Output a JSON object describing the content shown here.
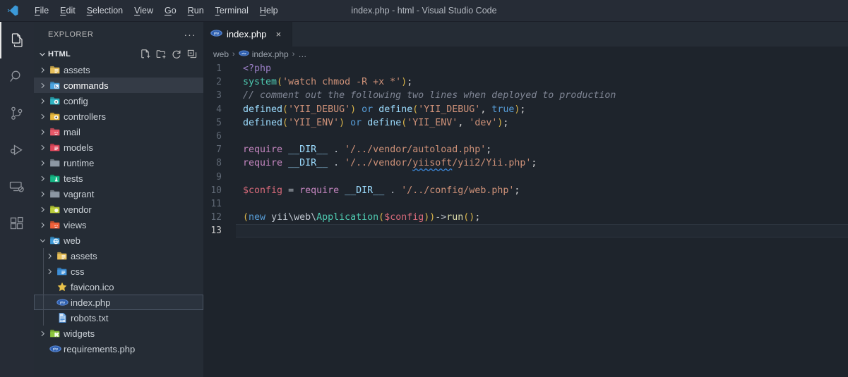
{
  "window": {
    "title": "index.php - html - Visual Studio Code",
    "logo_icon": "vscode-logo-icon"
  },
  "menubar": {
    "items": [
      {
        "label": "File",
        "mnemonic": "F"
      },
      {
        "label": "Edit",
        "mnemonic": "E"
      },
      {
        "label": "Selection",
        "mnemonic": "S"
      },
      {
        "label": "View",
        "mnemonic": "V"
      },
      {
        "label": "Go",
        "mnemonic": "G"
      },
      {
        "label": "Run",
        "mnemonic": "R"
      },
      {
        "label": "Terminal",
        "mnemonic": "T"
      },
      {
        "label": "Help",
        "mnemonic": "H"
      }
    ]
  },
  "activitybar": {
    "items": [
      {
        "name": "explorer",
        "icon": "files-icon",
        "active": true
      },
      {
        "name": "search",
        "icon": "search-icon",
        "active": false
      },
      {
        "name": "source-control",
        "icon": "source-control-icon",
        "active": false
      },
      {
        "name": "run-and-debug",
        "icon": "run-debug-icon",
        "active": false
      },
      {
        "name": "remote-explorer",
        "icon": "remote-explorer-icon",
        "active": false
      },
      {
        "name": "extensions",
        "icon": "extensions-icon",
        "active": false
      }
    ]
  },
  "sidebar": {
    "title": "EXPLORER",
    "more_actions_label": "···",
    "section": {
      "name": "HTML",
      "expanded": true,
      "actions": [
        {
          "name": "new-file",
          "icon": "new-file-icon"
        },
        {
          "name": "new-folder",
          "icon": "new-folder-icon"
        },
        {
          "name": "refresh-explorer",
          "icon": "refresh-icon"
        },
        {
          "name": "collapse-folders",
          "icon": "collapse-all-icon"
        }
      ]
    },
    "tree": [
      {
        "label": "assets",
        "kind": "folder",
        "icon": "folder-assets-icon",
        "color": "#e8c05a",
        "depth": 1,
        "expanded": false,
        "state": "normal"
      },
      {
        "label": "commands",
        "kind": "folder",
        "icon": "folder-commands-icon",
        "color": "#4aa3e0",
        "depth": 1,
        "expanded": false,
        "state": "focused"
      },
      {
        "label": "config",
        "kind": "folder",
        "icon": "folder-config-icon",
        "color": "#2fb6c4",
        "depth": 1,
        "expanded": false,
        "state": "normal"
      },
      {
        "label": "controllers",
        "kind": "folder",
        "icon": "folder-controllers-icon",
        "color": "#e8b93e",
        "depth": 1,
        "expanded": false,
        "state": "normal"
      },
      {
        "label": "mail",
        "kind": "folder",
        "icon": "folder-mail-icon",
        "color": "#e8596a",
        "depth": 1,
        "expanded": false,
        "state": "normal"
      },
      {
        "label": "models",
        "kind": "folder",
        "icon": "folder-models-icon",
        "color": "#e0485c",
        "depth": 1,
        "expanded": false,
        "state": "normal"
      },
      {
        "label": "runtime",
        "kind": "folder",
        "icon": "folder-icon",
        "color": "#8c97a3",
        "depth": 1,
        "expanded": false,
        "state": "normal"
      },
      {
        "label": "tests",
        "kind": "folder",
        "icon": "folder-tests-icon",
        "color": "#16b886",
        "depth": 1,
        "expanded": false,
        "state": "normal"
      },
      {
        "label": "vagrant",
        "kind": "folder",
        "icon": "folder-icon",
        "color": "#8c97a3",
        "depth": 1,
        "expanded": false,
        "state": "normal"
      },
      {
        "label": "vendor",
        "kind": "folder",
        "icon": "folder-vendor-icon",
        "color": "#bccf3b",
        "depth": 1,
        "expanded": false,
        "state": "normal"
      },
      {
        "label": "views",
        "kind": "folder",
        "icon": "folder-views-icon",
        "color": "#f0603a",
        "depth": 1,
        "expanded": false,
        "state": "normal"
      },
      {
        "label": "web",
        "kind": "folder",
        "icon": "folder-web-icon",
        "color": "#3e9ad8",
        "depth": 1,
        "expanded": true,
        "state": "normal"
      },
      {
        "label": "assets",
        "kind": "folder",
        "icon": "folder-assets-icon",
        "color": "#e8c05a",
        "depth": 2,
        "expanded": false,
        "state": "normal"
      },
      {
        "label": "css",
        "kind": "folder",
        "icon": "folder-css-icon",
        "color": "#3d8fd8",
        "depth": 2,
        "expanded": false,
        "state": "normal"
      },
      {
        "label": "favicon.ico",
        "kind": "file",
        "icon": "star-icon",
        "color": "#e8c14a",
        "depth": 2,
        "expanded": false,
        "state": "normal"
      },
      {
        "label": "index.php",
        "kind": "file",
        "icon": "php-icon",
        "color": "#4a76c4",
        "depth": 2,
        "expanded": false,
        "state": "selected"
      },
      {
        "label": "robots.txt",
        "kind": "file",
        "icon": "text-file-icon",
        "color": "#4a8fd8",
        "depth": 2,
        "expanded": false,
        "state": "normal"
      },
      {
        "label": "widgets",
        "kind": "folder",
        "icon": "folder-widgets-icon",
        "color": "#8cc63f",
        "depth": 1,
        "expanded": false,
        "state": "normal"
      },
      {
        "label": "requirements.php",
        "kind": "file",
        "icon": "php-icon",
        "color": "#4a76c4",
        "depth": 1,
        "expanded": false,
        "state": "normal"
      }
    ]
  },
  "editor": {
    "tabs": [
      {
        "label": "index.php",
        "icon": "php-icon",
        "active": true,
        "close_label": "×"
      }
    ],
    "breadcrumbs": [
      {
        "label": "web",
        "icon": null
      },
      {
        "label": "index.php",
        "icon": "php-icon"
      },
      {
        "label": "…",
        "icon": null
      }
    ],
    "breadcrumb_separator": "›",
    "active_line": 13,
    "line_numbers": [
      1,
      2,
      3,
      4,
      5,
      6,
      7,
      8,
      9,
      10,
      11,
      12,
      13
    ],
    "code_plain": [
      "<?php",
      "system('watch chmod -R +x *');",
      "// comment out the following two lines when deployed to production",
      "defined('YII_DEBUG') or define('YII_DEBUG', true);",
      "defined('YII_ENV') or define('YII_ENV', 'dev');",
      "",
      "require __DIR__ . '/../vendor/autoload.php';",
      "require __DIR__ . '/../vendor/yiisoft/yii2/Yii.php';",
      "",
      "$config = require __DIR__ . '/../config/web.php';",
      "",
      "(new yii\\web\\Application($config))->run();",
      ""
    ]
  },
  "colors": {
    "titlebar_bg": "#262c36",
    "activitybar_bg": "#262c36",
    "sidebar_bg": "#252c35",
    "editor_bg": "#1e242c",
    "accent_blue": "#4aa3e0",
    "string": "#ce9178",
    "comment": "#7f8594",
    "keyword": "#569cd6",
    "function": "#dcdcaa",
    "type": "#4ec9b0"
  }
}
